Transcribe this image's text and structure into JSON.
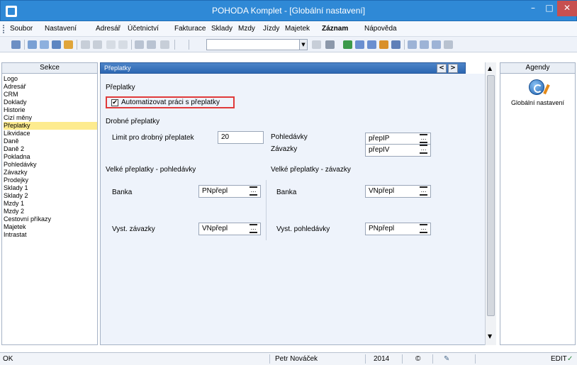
{
  "window": {
    "title": "POHODA Komplet - [Globální nastavení]",
    "min_label": "–",
    "max_label": "□",
    "close_label": "✕"
  },
  "menu": {
    "items": [
      "Soubor",
      "Nastavení",
      "Adresář",
      "Účetnictví",
      "Fakturace",
      "Sklady",
      "Mzdy",
      "Jízdy",
      "Majetek",
      "Záznam",
      "Nápověda"
    ]
  },
  "sections": {
    "header": "Sekce",
    "items": [
      "Logo",
      "Adresář",
      "CRM",
      "Doklady",
      "Historie",
      "Cizí měny",
      "Přeplatky",
      "Likvidace",
      "Daně",
      "Daně 2",
      "Pokladna",
      "Pohledávky",
      "Závazky",
      "Prodejky",
      "Sklady 1",
      "Sklady 2",
      "Mzdy 1",
      "Mzdy 2",
      "Cestovní příkazy",
      "Majetek",
      "Intrastat"
    ],
    "selected": "Přeplatky"
  },
  "panel": {
    "header": "Přeplatky",
    "nav_prev": "<",
    "nav_next": ">",
    "group_title": "Přeplatky",
    "auto_checkbox_label": "Automatizovat práci s přeplatky",
    "auto_checkbox_mark": "✔",
    "small_title": "Drobné přeplatky",
    "limit_label": "Limit pro drobný přeplatek",
    "limit_value": "20",
    "receivables_label": "Pohledávky",
    "receivables_value": "přepIP",
    "liabilities_label": "Závazky",
    "liabilities_value": "přepIV",
    "big_recv_title": "Velké přeplatky - pohledávky",
    "big_liab_title": "Velké přeplatky - závazky",
    "bank_label_left": "Banka",
    "bank_value_left": "PNpřepl",
    "bank_label_right": "Banka",
    "bank_value_right": "VNpřepl",
    "issued_liab_label": "Vyst. závazky",
    "issued_liab_value": "VNpřepl",
    "issued_recv_label": "Vyst. pohledávky",
    "issued_recv_value": "PNpřepl"
  },
  "agendas": {
    "header": "Agendy",
    "item_label": "Globální nastavení"
  },
  "status": {
    "state": "OK",
    "user": "Petr Nováček",
    "year": "2014",
    "mode": "EDIT"
  }
}
